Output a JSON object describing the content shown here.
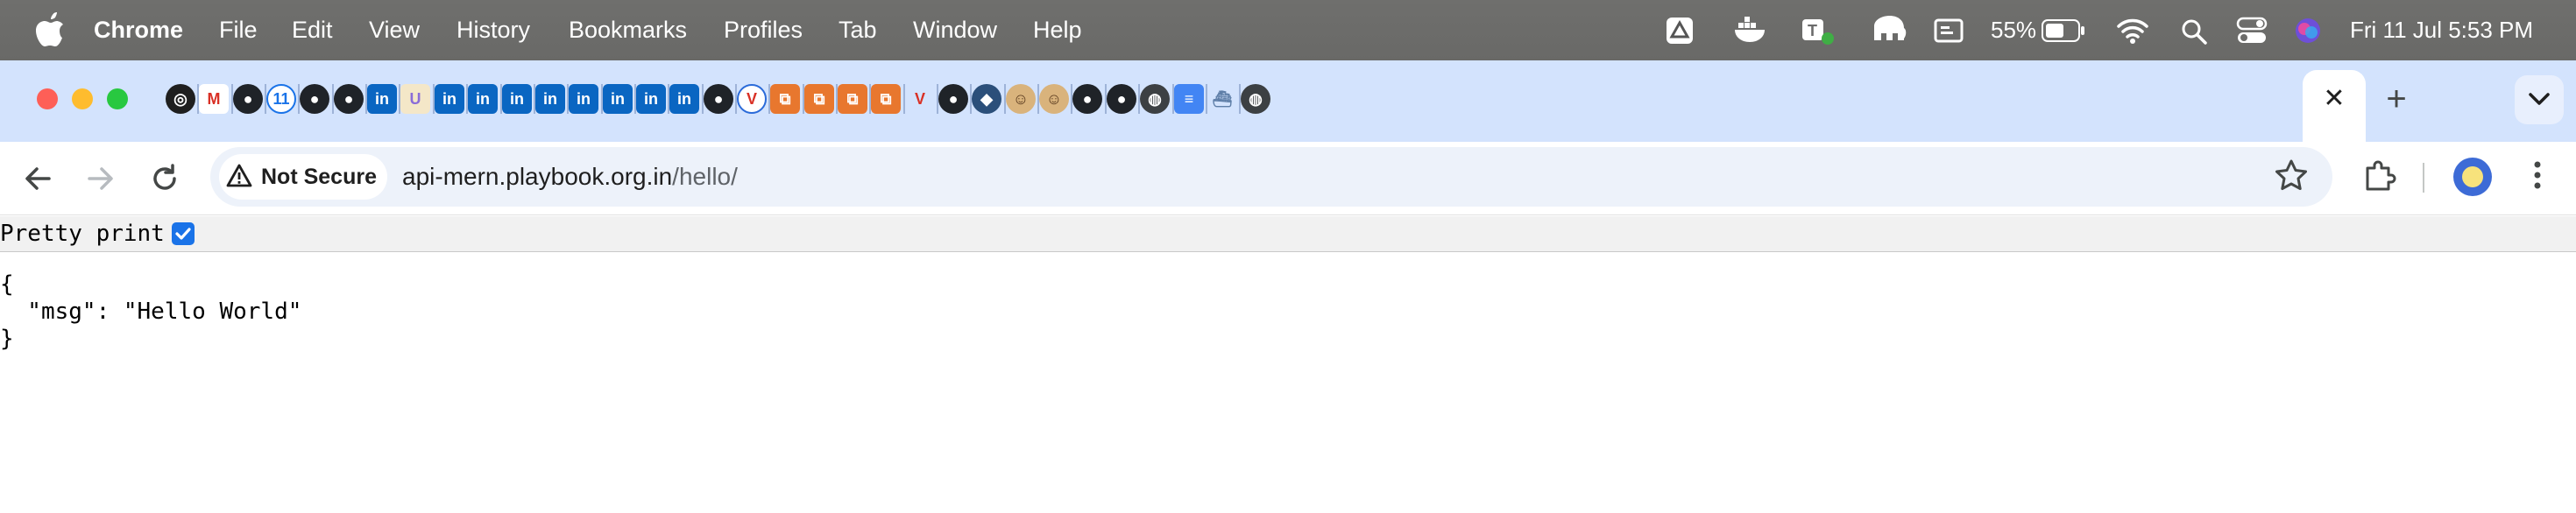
{
  "menubar": {
    "app_name": "Chrome",
    "items": [
      "File",
      "Edit",
      "View",
      "History",
      "Bookmarks",
      "Profiles",
      "Tab",
      "Window",
      "Help"
    ],
    "battery": "55%",
    "datetime": "Fri 11 Jul  5:53 PM"
  },
  "tabs": {
    "favicons": [
      "openai-icon",
      "gmail-icon",
      "github-icon",
      "calendar-icon",
      "github-icon",
      "github-icon",
      "linkedin-icon",
      "u-icon",
      "linkedin-icon",
      "linkedin-icon",
      "linkedin-icon",
      "linkedin-icon",
      "linkedin-icon",
      "linkedin-icon",
      "linkedin-icon",
      "linkedin-icon",
      "github-icon",
      "vercel-v-icon",
      "orange-box-icon",
      "orange-box-icon",
      "orange-box-icon",
      "orange-box-icon",
      "red-v-icon",
      "github-icon",
      "docker-icon",
      "avatar-icon",
      "avatar-icon",
      "github-icon",
      "github-icon",
      "globe-icon",
      "docs-icon",
      "whale-icon",
      "globe-icon"
    ],
    "close_symbol": "✕",
    "new_tab_symbol": "+"
  },
  "toolbar": {
    "security_label": "Not Secure",
    "url_host": "api-mern.playbook.org.in",
    "url_path": "/hello/"
  },
  "viewer": {
    "pretty_print_label": "Pretty print",
    "pretty_print_checked": true,
    "json_text": "{\n  \"msg\": \"Hello World\"\n}"
  }
}
